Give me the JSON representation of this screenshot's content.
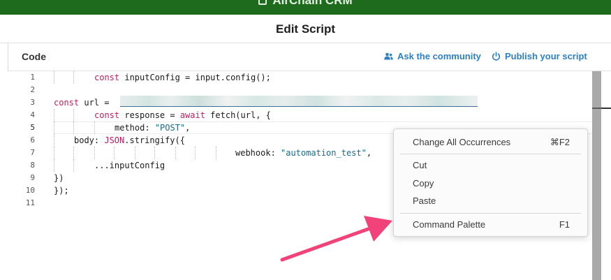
{
  "app": {
    "title": "AirChain CRM"
  },
  "dialog": {
    "title": "Edit Script"
  },
  "code_panel": {
    "label": "Code",
    "ask_community": "Ask the community",
    "publish_script": "Publish your script"
  },
  "editor": {
    "line_numbers": [
      "1",
      "2",
      "3",
      "4",
      "5",
      "6",
      "7",
      "8",
      "9",
      "10",
      "11"
    ],
    "active_line": "5",
    "lines": {
      "l1_kw": "const",
      "l1_rest": " inputConfig = input.config();",
      "l3_kw": "const",
      "l3_rest": " url = ",
      "l4_kw": "const",
      "l4_mid": " response = ",
      "l4_kw2": "await",
      "l4_rest": " fetch(url, {",
      "l5_key": "method: ",
      "l5_str": "\"POST\"",
      "l5_end": ",",
      "l6_key": "body: ",
      "l6_obj": "JSON",
      "l6_rest": ".stringify({",
      "l7_key": "webhook: ",
      "l7_str": "\"automation_test\"",
      "l7_end": ",",
      "l8": "...inputConfig",
      "l9": "})",
      "l10": "});"
    }
  },
  "context_menu": {
    "items": [
      {
        "label": "Change All Occurrences",
        "shortcut": "⌘F2"
      },
      {
        "label": "Cut",
        "shortcut": ""
      },
      {
        "label": "Copy",
        "shortcut": ""
      },
      {
        "label": "Paste",
        "shortcut": ""
      },
      {
        "label": "Command Palette",
        "shortcut": "F1"
      }
    ]
  },
  "icons": {
    "community": "people-icon",
    "publish": "power-icon"
  },
  "colors": {
    "topbar": "#1e6b1e",
    "link": "#2d7fc4",
    "keyword": "#c41a5a",
    "string": "#1a6b8a",
    "arrow": "#f2427a"
  }
}
